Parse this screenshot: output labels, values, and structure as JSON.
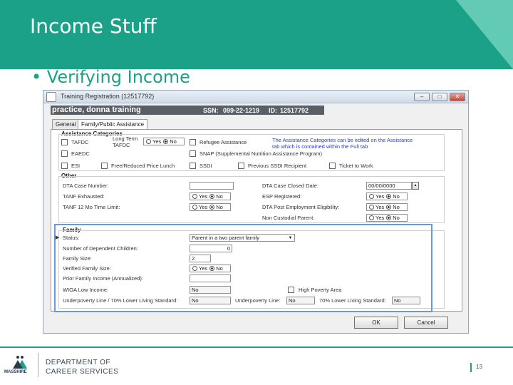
{
  "slide": {
    "title": "Income Stuff",
    "bullet_symbol": "•",
    "bullet": "Verifying Income",
    "page_number": "13",
    "footer": {
      "logo_text": "MASSHIRE",
      "dept_line1": "DEPARTMENT OF",
      "dept_line2": "CAREER SERVICES"
    },
    "colors": {
      "brand": "#1aa187",
      "accent": "#63cbb5"
    }
  },
  "window": {
    "title": "Training Registration (12517792)",
    "buttons": {
      "minimize": "‒",
      "maximize": "□",
      "close": "✕"
    },
    "user_name": "practice, donna training",
    "ssn_label": "SSN:",
    "ssn_value": "099-22-1219",
    "id_label": "ID:",
    "id_value": "12517792",
    "tabs": [
      "General",
      "Family/Public Assistance"
    ],
    "yes": "Yes",
    "no": "No",
    "assistance": {
      "heading": "Assistance Categories",
      "items": [
        "TAFDC",
        "EAEDC",
        "ESI",
        "Long Term TAFDC",
        "Free/Reduced Price Lunch",
        "Refugee Assistance",
        "SNAP (Supplemental Nutrition Assistance Program)",
        "SSDI",
        "Previous SSDI Recipient",
        "Ticket to Work"
      ],
      "note": "The Assistance Categories can be edited on the Assistance tab which is contained within the Full tab"
    },
    "other": {
      "heading": "Other",
      "dta_case_number": "DTA Case Number:",
      "tanf_exhausted": "TANF Exhausted:",
      "tanf_limit": "TANF 12 Mo Time Limit:",
      "dta_case_closed": "DTA Case Closed Date:",
      "dta_case_closed_value": "00/00/0000",
      "esp_registered": "ESP Registered:",
      "dta_post_eligibility": "DTA Post Employment Eligibility:",
      "non_custodial": "Non Custodial Parent:"
    },
    "family": {
      "heading": "Family",
      "status_label": "Status:",
      "status_value": "Parent in a two parent family",
      "dependents_label": "Number of Dependent Children:",
      "dependents_value": "0",
      "size_label": "Family Size:",
      "size_value": "2",
      "verified_label": "Verified Family Size:",
      "income_label": "Prior Family Income (Annualized):",
      "income_value": "",
      "wioa_label": "WIOA Low Income:",
      "wioa_value": "No",
      "high_poverty_label": "High Poverty Area",
      "underpoverty_70_label": "Underpoverty Line / 70% Lower Living Standard:",
      "underpoverty_70_value": "No",
      "underpoverty_label": "Underpoverty Line:",
      "underpoverty_value": "No",
      "lower_living_label": "70% Lower Living Standard:",
      "lower_living_value": "No"
    },
    "ok_button": "OK",
    "cancel_button": "Cancel"
  }
}
